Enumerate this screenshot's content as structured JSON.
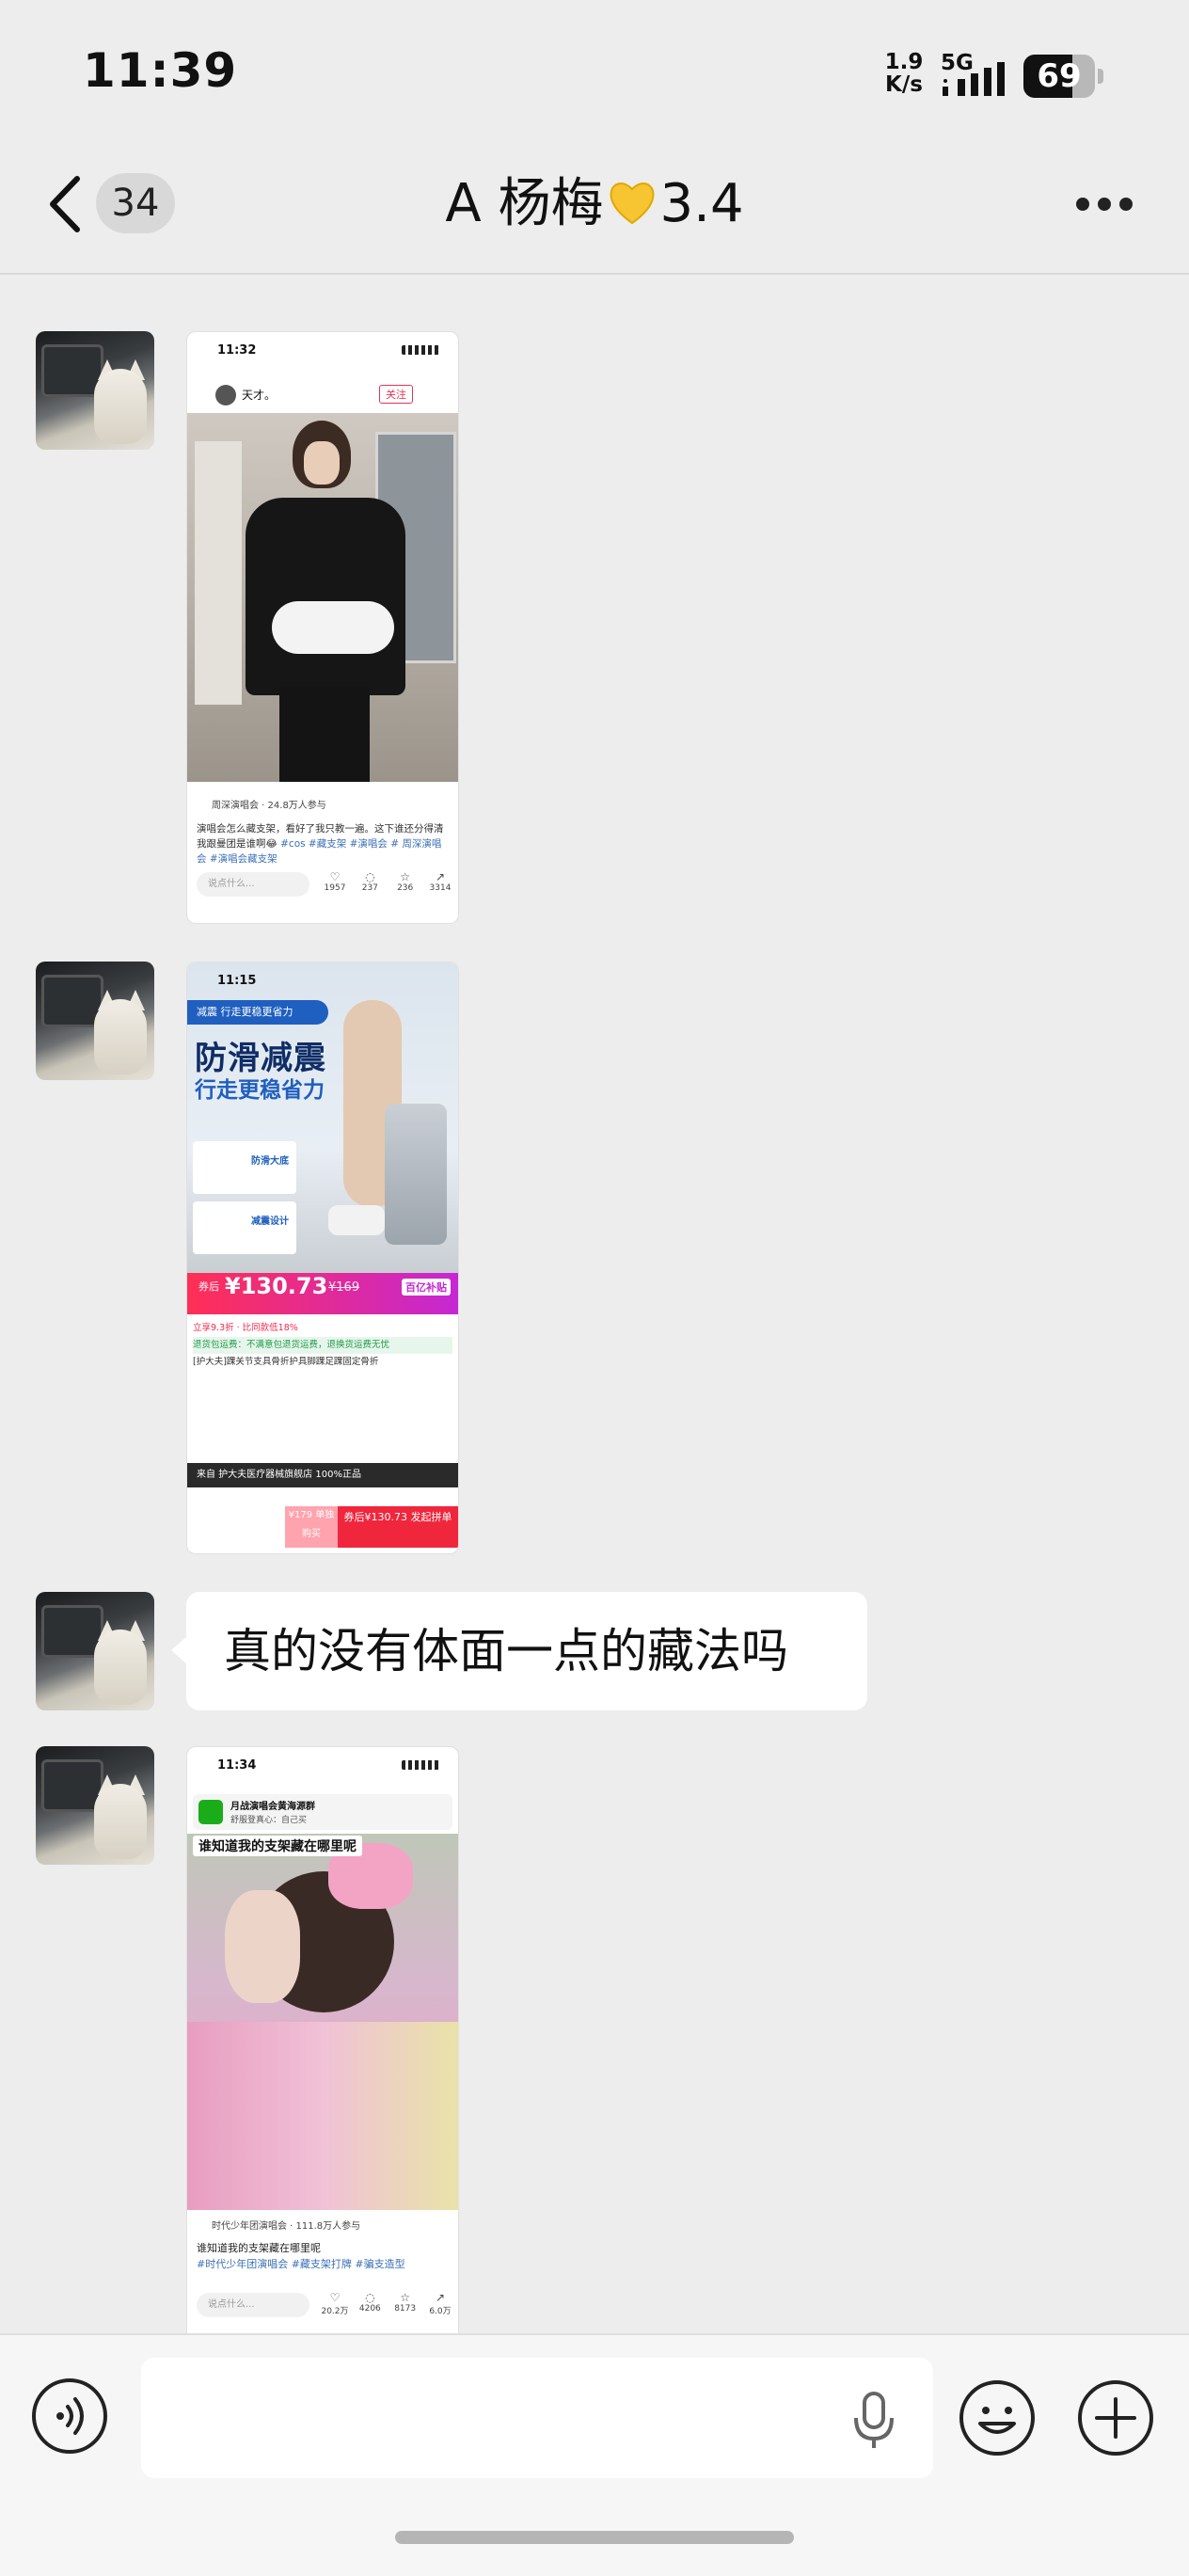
{
  "status_bar": {
    "time": "11:39",
    "net_speed_value": "1.9",
    "net_speed_unit": "K/s",
    "network": "5G",
    "battery": "69",
    "battery_level": 0.69
  },
  "nav": {
    "unread_count": "34",
    "title_prefix": "A 杨梅",
    "title_suffix": "3.4",
    "title_icon": "yellow-heart-icon"
  },
  "messages": [
    {
      "type": "image",
      "thumb": {
        "time": "11:32",
        "username": "天才。",
        "follow_label": "关注",
        "author": "周深演唱会 · 24.8万人参与",
        "caption": "演唱会怎么藏支架，看好了我只教一遍。这下谁还分得清我跟曼团是谁啊😂 #cos #藏支架 #演唱会 # 周深演唱会 #演唱会藏支架",
        "caption_tags": "#cos #藏支架 #演唱会 # 周深演唱会 #演唱会藏支架",
        "caption_text": "演唱会怎么藏支架，看好了我只教一遍。这下谁还分得清我跟曼团是谁啊😂",
        "input_placeholder": "说点什么...",
        "stats": [
          "1957",
          "237",
          "236",
          "3314"
        ]
      }
    },
    {
      "type": "image",
      "thumb": {
        "time": "11:15",
        "banner": "减震 行走更稳更省力",
        "headline1": "防滑减震",
        "headline2": "行走更稳省力",
        "card1": "防滑大底",
        "card2": "减震设计",
        "price_label": "券后",
        "price": "¥130.73",
        "original_price": "¥169",
        "price_badge": "百亿补贴",
        "line1": "立享9.3折 · 比同款低18%",
        "line2": "退货包运费：不满意包退货运费，退换货运费无忧",
        "line3": "[护大夫]踝关节支具骨折护具脚踝足踝固定骨折",
        "shop": "来自 护大夫医疗器械旗舰店 100%正品",
        "bottom_left": "¥179 单独购买",
        "bottom_right": "券后¥130.73 发起拼单"
      }
    },
    {
      "type": "text",
      "text": "真的没有体面一点的藏法吗"
    },
    {
      "type": "image",
      "thumb": {
        "time": "11:34",
        "notice_title": "月战演唱会黄海源群",
        "notice_sub": "舒服登真心：自己买",
        "overlay": "谁知道我的支架藏在哪里呢",
        "author": "时代少年团演唱会 · 111.8万人参与",
        "caption_text": "谁知道我的支架藏在哪里呢",
        "caption_tags": "#时代少年团演唱会 #藏支架打牌 #骗支造型",
        "input_placeholder": "说点什么...",
        "stats": [
          "20.2万",
          "4206",
          "8173",
          "6.0万"
        ]
      }
    }
  ],
  "input_bar": {
    "placeholder": ""
  }
}
